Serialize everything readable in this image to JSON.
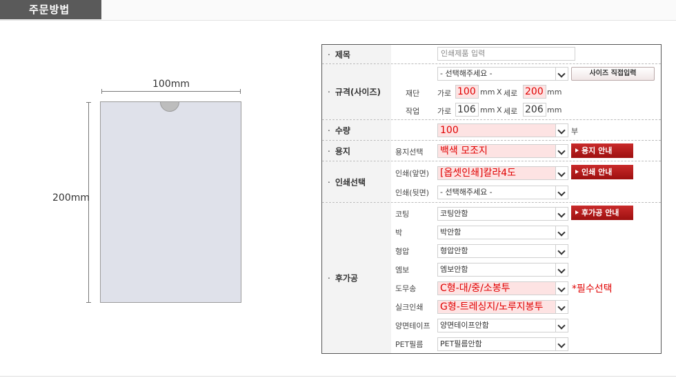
{
  "header": {
    "title": "주문방법"
  },
  "preview": {
    "width_label": "100mm",
    "height_label": "200mm"
  },
  "form": {
    "title": {
      "label": "제목",
      "placeholder": "인쇄제품 입력"
    },
    "size": {
      "label": "규격(사이즈)",
      "select_value": "- 선택해주세요 -",
      "direct_button": "사이즈 직접입력",
      "cut": {
        "label": "재단",
        "w_label": "가로",
        "w_value": "100",
        "unit": "mm",
        "x": "X",
        "h_label": "세로",
        "h_value": "200"
      },
      "work": {
        "label": "작업",
        "w_label": "가로",
        "w_value": "106",
        "unit": "mm",
        "x": "X",
        "h_label": "세로",
        "h_value": "206"
      }
    },
    "quantity": {
      "label": "수량",
      "value": "100",
      "unit": "부"
    },
    "paper": {
      "label": "용지",
      "sub_label": "용지선택",
      "value": "백색 모조지",
      "guide_button": "용지 안내"
    },
    "print": {
      "label": "인쇄선택",
      "front_label": "인쇄(앞면)",
      "front_value": "[옵셋인쇄]칼라4도",
      "guide_button": "인쇄 안내",
      "back_label": "인쇄(뒷면)",
      "back_value": "- 선택해주세요 -"
    },
    "finishing": {
      "label": "후가공",
      "guide_button": "후가공 안내",
      "required_note": "*필수선택",
      "items": [
        {
          "label": "코팅",
          "value": "코팅안함"
        },
        {
          "label": "박",
          "value": "박안함"
        },
        {
          "label": "형압",
          "value": "형압안함"
        },
        {
          "label": "엠보",
          "value": "엠보안함"
        },
        {
          "label": "도무송",
          "value": "C형-대/중/소봉투"
        },
        {
          "label": "실크인쇄",
          "value": "G형-트레싱지/노루지봉투"
        },
        {
          "label": "양면테이프",
          "value": "양면테이프안함"
        },
        {
          "label": "PET필름",
          "value": "PET필름안함"
        }
      ]
    }
  }
}
